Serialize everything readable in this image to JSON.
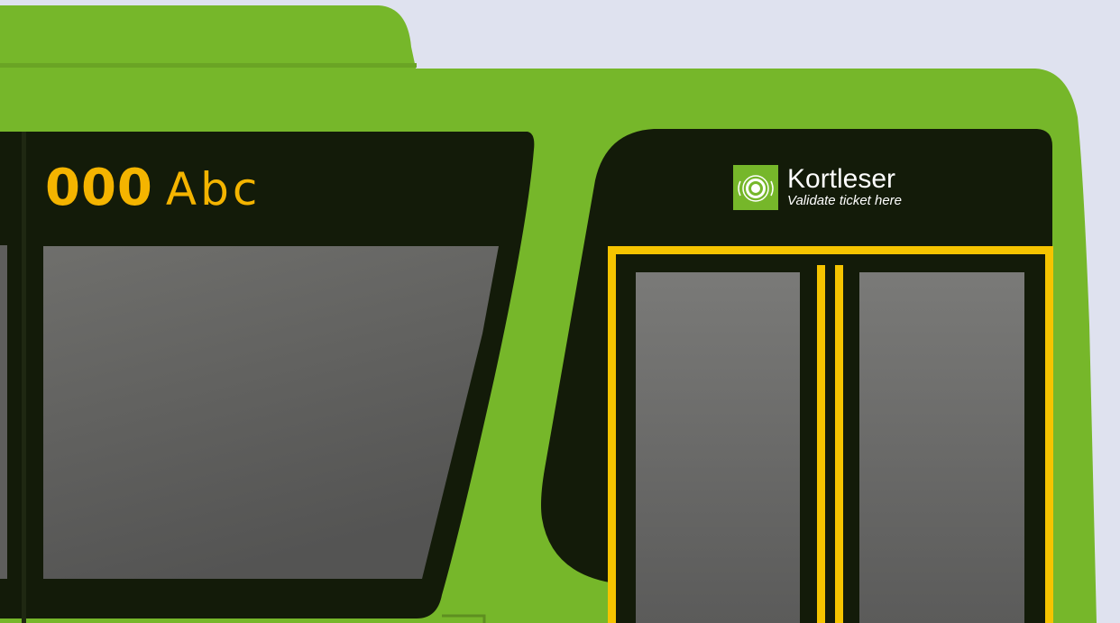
{
  "route_sign": {
    "number": "000",
    "name": "Abc"
  },
  "ticket_validator": {
    "title": "Kortleser",
    "subtitle": "Validate ticket here",
    "icon": "contactless-card-reader-icon"
  },
  "colors": {
    "body_green": "#76b72a",
    "window_black": "#131b09",
    "door_yellow": "#f5c400",
    "sky": "#dfe2ef",
    "sign_amber": "#f4b400"
  }
}
